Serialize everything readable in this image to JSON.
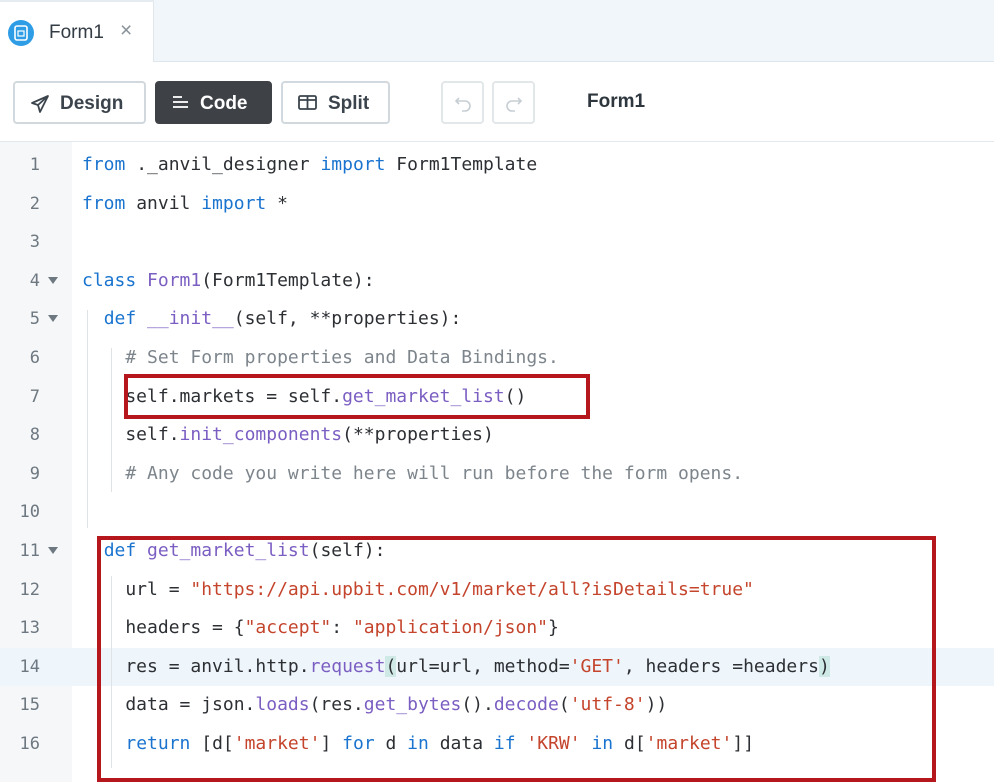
{
  "tab": {
    "title": "Form1",
    "close": "×"
  },
  "toolbar": {
    "design_label": "Design",
    "code_label": "Code",
    "split_label": "Split",
    "form_name": "Form1"
  },
  "editor": {
    "active_line": 14,
    "lines": [
      {
        "n": "1",
        "fold": false,
        "tokens": [
          {
            "t": "kw",
            "s": "from"
          },
          {
            "t": "",
            "s": " ._anvil_designer "
          },
          {
            "t": "kw",
            "s": "import"
          },
          {
            "t": "",
            "s": " Form1Template"
          }
        ]
      },
      {
        "n": "2",
        "fold": false,
        "tokens": [
          {
            "t": "kw",
            "s": "from"
          },
          {
            "t": "",
            "s": " anvil "
          },
          {
            "t": "kw",
            "s": "import"
          },
          {
            "t": "",
            "s": " *"
          }
        ]
      },
      {
        "n": "3",
        "fold": false,
        "tokens": []
      },
      {
        "n": "4",
        "fold": true,
        "tokens": [
          {
            "t": "kw",
            "s": "class"
          },
          {
            "t": "",
            "s": " "
          },
          {
            "t": "fn",
            "s": "Form1"
          },
          {
            "t": "",
            "s": "(Form1Template):"
          }
        ]
      },
      {
        "n": "5",
        "fold": true,
        "tokens": [
          {
            "t": "",
            "s": "  "
          },
          {
            "t": "kw",
            "s": "def"
          },
          {
            "t": "",
            "s": " "
          },
          {
            "t": "fn",
            "s": "__init__"
          },
          {
            "t": "",
            "s": "(self, **properties):"
          }
        ]
      },
      {
        "n": "6",
        "fold": false,
        "tokens": [
          {
            "t": "",
            "s": "    "
          },
          {
            "t": "cm",
            "s": "# Set Form properties and Data Bindings."
          }
        ]
      },
      {
        "n": "7",
        "fold": false,
        "tokens": [
          {
            "t": "",
            "s": "    self.markets = self."
          },
          {
            "t": "fn",
            "s": "get_market_list"
          },
          {
            "t": "",
            "s": "()"
          }
        ]
      },
      {
        "n": "8",
        "fold": false,
        "tokens": [
          {
            "t": "",
            "s": "    self."
          },
          {
            "t": "fn",
            "s": "init_components"
          },
          {
            "t": "",
            "s": "(**properties)"
          }
        ]
      },
      {
        "n": "9",
        "fold": false,
        "tokens": [
          {
            "t": "",
            "s": "    "
          },
          {
            "t": "cm",
            "s": "# Any code you write here will run before the form opens."
          }
        ]
      },
      {
        "n": "10",
        "fold": false,
        "tokens": []
      },
      {
        "n": "11",
        "fold": true,
        "tokens": [
          {
            "t": "",
            "s": "  "
          },
          {
            "t": "kw",
            "s": "def"
          },
          {
            "t": "",
            "s": " "
          },
          {
            "t": "fn",
            "s": "get_market_list"
          },
          {
            "t": "",
            "s": "(self):"
          }
        ]
      },
      {
        "n": "12",
        "fold": false,
        "tokens": [
          {
            "t": "",
            "s": "    url = "
          },
          {
            "t": "str",
            "s": "\"https://api.upbit.com/v1/market/all?isDetails=true\""
          }
        ]
      },
      {
        "n": "13",
        "fold": false,
        "tokens": [
          {
            "t": "",
            "s": "    headers = {"
          },
          {
            "t": "str",
            "s": "\"accept\""
          },
          {
            "t": "",
            "s": ": "
          },
          {
            "t": "str",
            "s": "\"application/json\""
          },
          {
            "t": "",
            "s": "}"
          }
        ]
      },
      {
        "n": "14",
        "fold": false,
        "tokens": [
          {
            "t": "",
            "s": "    res = anvil.http."
          },
          {
            "t": "fn",
            "s": "request"
          },
          {
            "t": "paren-hl",
            "s": "("
          },
          {
            "t": "",
            "s": "url=url, method="
          },
          {
            "t": "str",
            "s": "'GET'"
          },
          {
            "t": "",
            "s": ", headers =headers"
          },
          {
            "t": "paren-hl",
            "s": ")"
          }
        ]
      },
      {
        "n": "15",
        "fold": false,
        "tokens": [
          {
            "t": "",
            "s": "    data = json."
          },
          {
            "t": "fn",
            "s": "loads"
          },
          {
            "t": "",
            "s": "(res."
          },
          {
            "t": "fn",
            "s": "get_bytes"
          },
          {
            "t": "",
            "s": "()."
          },
          {
            "t": "fn",
            "s": "decode"
          },
          {
            "t": "",
            "s": "("
          },
          {
            "t": "str",
            "s": "'utf-8'"
          },
          {
            "t": "",
            "s": "))"
          }
        ]
      },
      {
        "n": "16",
        "fold": false,
        "tokens": [
          {
            "t": "",
            "s": "    "
          },
          {
            "t": "kw",
            "s": "return"
          },
          {
            "t": "",
            "s": " [d["
          },
          {
            "t": "str",
            "s": "'market'"
          },
          {
            "t": "",
            "s": "] "
          },
          {
            "t": "kw",
            "s": "for"
          },
          {
            "t": "",
            "s": " d "
          },
          {
            "t": "kw",
            "s": "in"
          },
          {
            "t": "",
            "s": " data "
          },
          {
            "t": "kw",
            "s": "if"
          },
          {
            "t": "",
            "s": " "
          },
          {
            "t": "str",
            "s": "'KRW'"
          },
          {
            "t": "",
            "s": " "
          },
          {
            "t": "kw",
            "s": "in"
          },
          {
            "t": "",
            "s": " d["
          },
          {
            "t": "str",
            "s": "'market'"
          },
          {
            "t": "",
            "s": "]]"
          }
        ]
      }
    ]
  },
  "colors": {
    "keyword": "#1a74cf",
    "function": "#7b5ec2",
    "string": "#c4442c",
    "comment": "#7d858c",
    "highlight_box": "#b5171d",
    "tab_icon": "#2e9de6",
    "code_button_bg": "#3e4246"
  },
  "icons": {
    "tab": "form-file-icon",
    "design": "paper-plane-icon",
    "code": "code-lines-icon",
    "split": "split-view-icon",
    "undo": "undo-icon",
    "redo": "redo-icon"
  }
}
